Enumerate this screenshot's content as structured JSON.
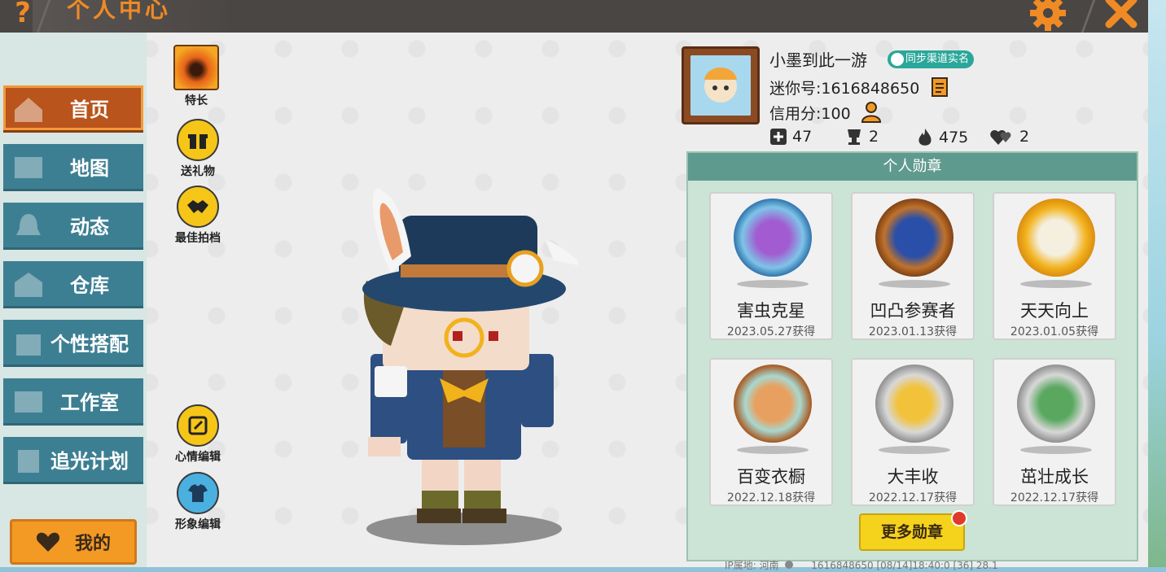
{
  "header": {
    "title": "个人中心",
    "help_icon": "question-icon",
    "settings_icon": "gear-icon",
    "close_icon": "close-icon"
  },
  "sidebar": {
    "items": [
      {
        "label": "首页",
        "icon": "home-icon",
        "active": true
      },
      {
        "label": "地图",
        "icon": "map-icon",
        "active": false
      },
      {
        "label": "动态",
        "icon": "bell-icon",
        "active": false
      },
      {
        "label": "仓库",
        "icon": "warehouse-icon",
        "active": false
      },
      {
        "label": "个性搭配",
        "icon": "outfit-icon",
        "active": false
      },
      {
        "label": "工作室",
        "icon": "studio-icon",
        "active": false
      },
      {
        "label": "追光计划",
        "icon": "spotlight-icon",
        "active": false
      }
    ],
    "mine_label": "我的"
  },
  "actions": {
    "specialty": "特长",
    "gift": "送礼物",
    "partner": "最佳拍档",
    "mood_edit": "心情编辑",
    "image_edit": "形象编辑"
  },
  "profile": {
    "name": "小墨到此一游",
    "sync_badge": "同步渠道实名",
    "mini_id": "迷你号:1616848650",
    "credit": "信用分:100",
    "stats": {
      "plus": "47",
      "trophy": "2",
      "fire": "475",
      "hearts": "2"
    }
  },
  "medals": {
    "title": "个人勋章",
    "items": [
      {
        "name": "害虫克星",
        "date": "2023.05.27获得",
        "ring": "#7ec4e8"
      },
      {
        "name": "凹凸参赛者",
        "date": "2023.01.13获得",
        "ring": "#c0722a"
      },
      {
        "name": "天天向上",
        "date": "2023.01.05获得",
        "ring": "#f2b21c"
      },
      {
        "name": "百变衣橱",
        "date": "2022.12.18获得",
        "ring": "#c0722a"
      },
      {
        "name": "大丰收",
        "date": "2022.12.17获得",
        "ring": "#b8b8b8"
      },
      {
        "name": "茁壮成长",
        "date": "2022.12.17获得",
        "ring": "#b8b8b8"
      }
    ],
    "more_label": "更多勋章"
  },
  "footer": {
    "ip_location": "IP属地: 河南",
    "info_text": "1616848650    [08/14]18:40:0    [36] 28.1"
  },
  "colors": {
    "accent_orange": "#f08a24",
    "sidebar_teal": "#3d7f92",
    "active_brown": "#b8541c",
    "medal_header": "#5f9a8e",
    "more_button": "#f5d21c"
  }
}
